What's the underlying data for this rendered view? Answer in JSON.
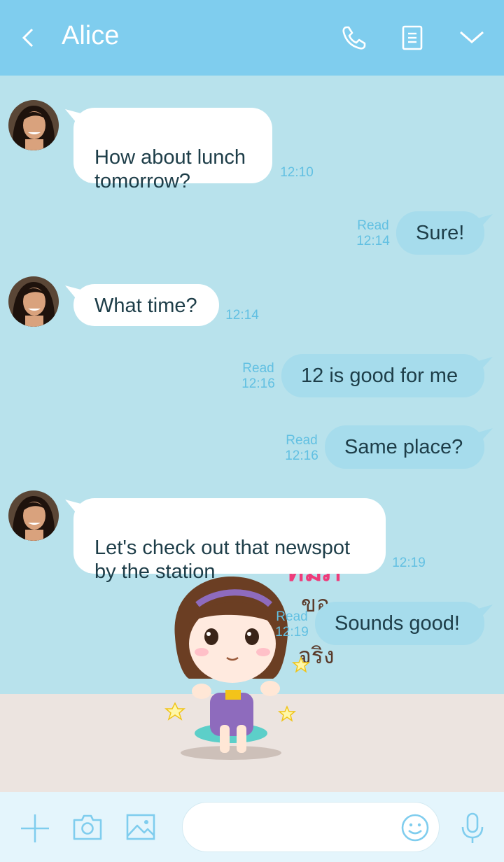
{
  "header": {
    "title": "Alice"
  },
  "messages": [
    {
      "text": "How about lunch\ntomorrow?",
      "time": "12:10"
    },
    {
      "read": "Read",
      "time": "12:14",
      "text": "Sure!"
    },
    {
      "text": "What time?",
      "time": "12:14"
    },
    {
      "read": "Read",
      "time": "12:16",
      "text": "12 is good for me"
    },
    {
      "read": "Read",
      "time": "12:16",
      "text": "Same place?"
    },
    {
      "text": "Let's check out that newspot\nby the station",
      "time": "12:19"
    },
    {
      "read": "Read",
      "time": "12:19",
      "text": "Sounds good!"
    }
  ],
  "sticker": {
    "caption": "ขอ ... จริง"
  },
  "colors": {
    "header": "#7fcdee",
    "chat_bg": "#b8e2ec",
    "outgoing_bubble": "#a6dcec",
    "incoming_bubble": "#ffffff",
    "time_text": "#62c0e2"
  },
  "icons": [
    "back-icon",
    "phone-icon",
    "notes-icon",
    "chevron-down-icon",
    "plus-icon",
    "camera-icon",
    "image-icon",
    "emoji-icon",
    "microphone-icon"
  ]
}
